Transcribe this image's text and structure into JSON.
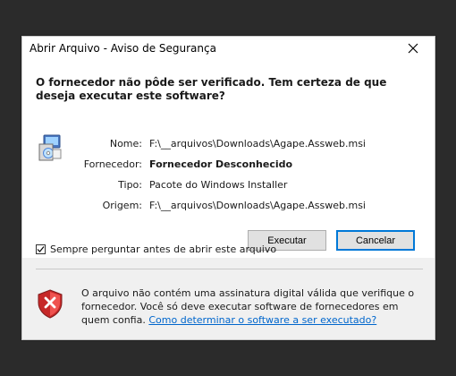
{
  "window": {
    "title": "Abrir Arquivo - Aviso de Segurança",
    "close_icon": "close-icon"
  },
  "main": {
    "question": "O fornecedor não pôde ser verificado. Tem certeza de que deseja executar este software?",
    "file_icon": "msi-package-icon",
    "details": {
      "name_label": "Nome:",
      "name_value": "F:\\__arquivos\\Downloads\\Agape.Assweb.msi",
      "publisher_label": "Fornecedor:",
      "publisher_value": "Fornecedor Desconhecido",
      "type_label": "Tipo:",
      "type_value": "Pacote do Windows Installer",
      "origin_label": "Origem:",
      "origin_value": "F:\\__arquivos\\Downloads\\Agape.Assweb.msi"
    },
    "buttons": {
      "run": "Executar",
      "cancel": "Cancelar"
    }
  },
  "checkbox": {
    "label": "Sempre perguntar antes de abrir este arquivo",
    "checked": true
  },
  "footer": {
    "shield_icon": "security-shield-x-icon",
    "warning_text": "O arquivo não contém uma assinatura digital válida que verifique o fornecedor. Você só deve executar software de fornecedores em quem confia.",
    "help_link": "Como determinar o software a ser executado?"
  },
  "colors": {
    "background": "#2b2b2b",
    "dialog": "#f0f0f0",
    "panel": "#ffffff",
    "accent": "#0078d7",
    "link": "#0066cc",
    "danger": "#d32f2f"
  }
}
